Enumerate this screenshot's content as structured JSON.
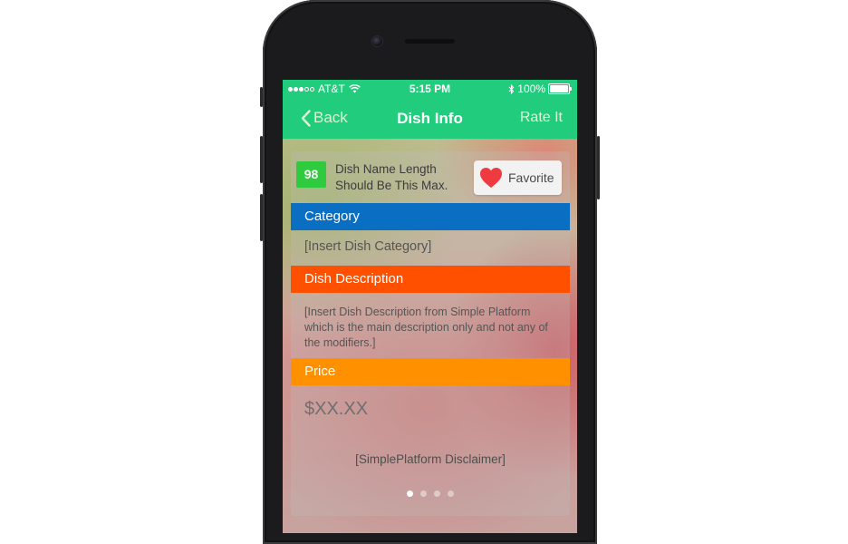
{
  "status_bar": {
    "carrier": "AT&T",
    "time": "5:15 PM",
    "battery": "100%",
    "signal_bars_filled": 3,
    "signal_bars_total": 5
  },
  "nav": {
    "back_label": "Back",
    "title": "Dish Info",
    "right_label": "Rate It"
  },
  "dish": {
    "score": "98",
    "name": "Dish Name Length Should Be This Max.",
    "favorite_label": "Favorite"
  },
  "sections": {
    "category": {
      "header": "Category",
      "value": "[Insert Dish Category]",
      "color": "#0a6fc2"
    },
    "description": {
      "header": "Dish Description",
      "value": "[Insert Dish Description from Simple Platform which is the main description only and not any of the modifiers.]",
      "color": "#ff5000"
    },
    "price": {
      "header": "Price",
      "value": "$XX.XX",
      "color": "#ff9100"
    }
  },
  "disclaimer": "[SimplePlatform Disclaimer]",
  "pager": {
    "pages": 4,
    "active": 1
  },
  "colors": {
    "brand_green": "#22cc7d",
    "score_green": "#2fcb3f",
    "heart_red": "#ef3b3f"
  },
  "icons": {
    "back": "chevron-left-icon",
    "wifi": "wifi-icon",
    "bluetooth": "bluetooth-icon",
    "battery": "battery-icon",
    "favorite": "heart-icon"
  }
}
